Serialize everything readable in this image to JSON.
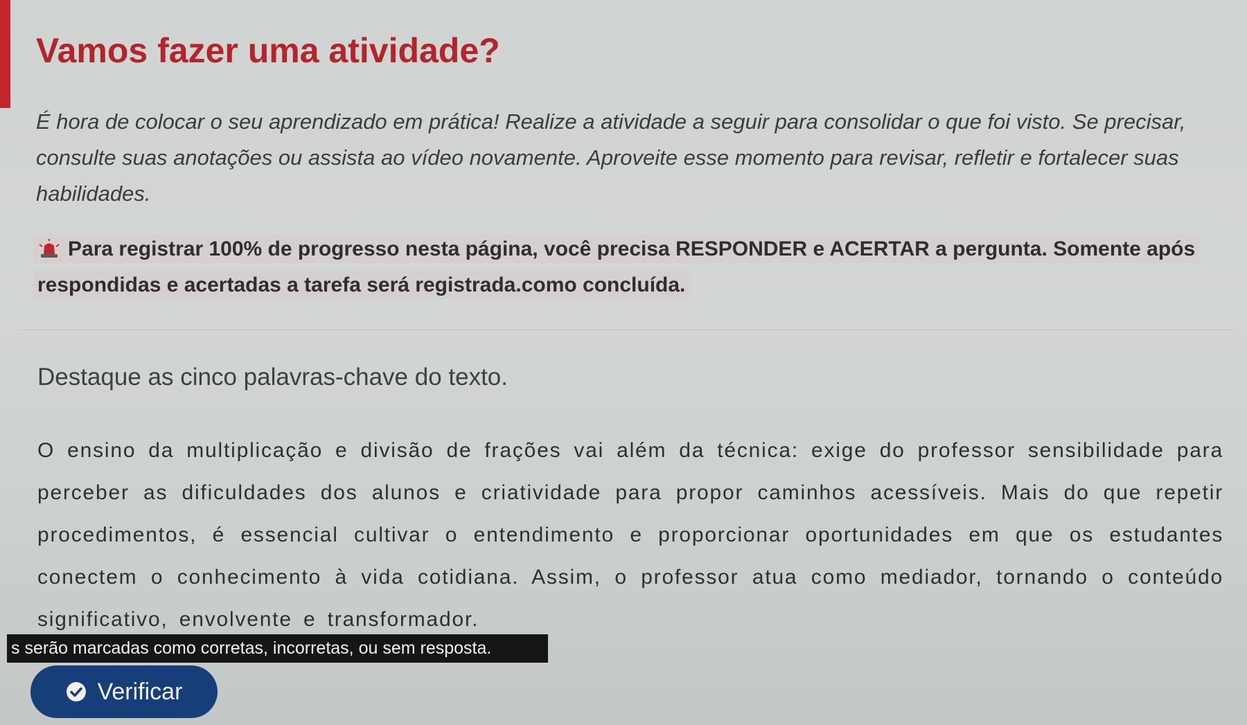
{
  "activity": {
    "title": "Vamos fazer uma atividade?",
    "intro": "É hora de colocar o seu aprendizado em prática! Realize a atividade a seguir para consolidar o que foi visto. Se precisar, consulte suas anotações ou assista ao vídeo novamente. Aproveite esse momento para revisar, refletir e fortalecer suas habilidades.",
    "notice_icon": "alarm-siren-icon",
    "notice": "Para registrar 100% de progresso nesta página, você precisa RESPONDER e ACERTAR a pergunta. Somente após respondidas e acertadas a tarefa será registrada.como concluída."
  },
  "question": {
    "prompt": "Destaque as cinco palavras-chave do texto.",
    "passage": "O ensino da multiplicação e divisão de frações vai além da técnica: exige do professor sensibilidade para perceber as dificuldades dos alunos e criatividade para propor caminhos acessíveis. Mais do que repetir procedimentos, é essencial cultivar o entendimento e proporcionar oportunidades em que os estudantes conectem o conhecimento à vida cotidiana. Assim, o professor atua como mediador, tornando o conteúdo significativo, envolvente e transformador."
  },
  "tooltip": {
    "text": "s serão marcadas como corretas, incorretas, ou sem resposta."
  },
  "actions": {
    "verify_label": "Verificar",
    "verify_icon": "check-circle-icon"
  },
  "colors": {
    "accent_red": "#c4262e",
    "title_red": "#b4252b",
    "button_blue": "#163f79",
    "tooltip_bg": "#161616"
  }
}
